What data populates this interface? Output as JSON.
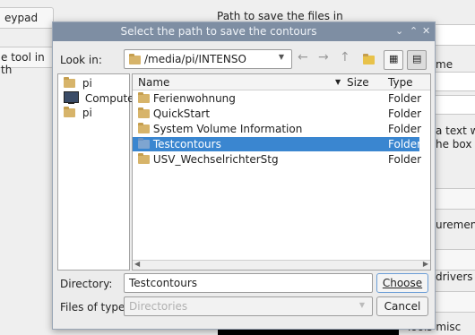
{
  "background": {
    "keypad_button": "eypad",
    "path_title": "Path to save the files in",
    "tool_button": "e tool in th",
    "right_texts": [
      "me",
      "a text wi",
      "he box it",
      "urement t",
      "drivers",
      "Tools misc"
    ]
  },
  "dialog": {
    "title": "Select the path to save the contours",
    "look_in_label": "Look in:",
    "look_in_value": "/media/pi/INTENSO",
    "sidebar": [
      {
        "label": "pi",
        "icon": "folder-icon"
      },
      {
        "label": "Computer",
        "icon": "computer-icon"
      },
      {
        "label": "pi",
        "icon": "folder-icon"
      }
    ],
    "columns": [
      "Name",
      "Size",
      "Type"
    ],
    "files": [
      {
        "name": "Ferienwohnung",
        "type": "Folder",
        "selected": false
      },
      {
        "name": "QuickStart",
        "type": "Folder",
        "selected": false
      },
      {
        "name": "System Volume Information",
        "type": "Folder",
        "selected": false
      },
      {
        "name": "Testcontours",
        "type": "Folder",
        "selected": true
      },
      {
        "name": "USV_WechselrichterStg",
        "type": "Folder",
        "selected": false
      }
    ],
    "directory_label": "Directory:",
    "directory_value": "Testcontours",
    "filetype_label": "Files of type:",
    "filetype_value": "Directories",
    "choose_button": "Choose",
    "cancel_button": "Cancel",
    "colors": {
      "titlebar": "#7e8ea3",
      "selection": "#3a86d0"
    }
  }
}
